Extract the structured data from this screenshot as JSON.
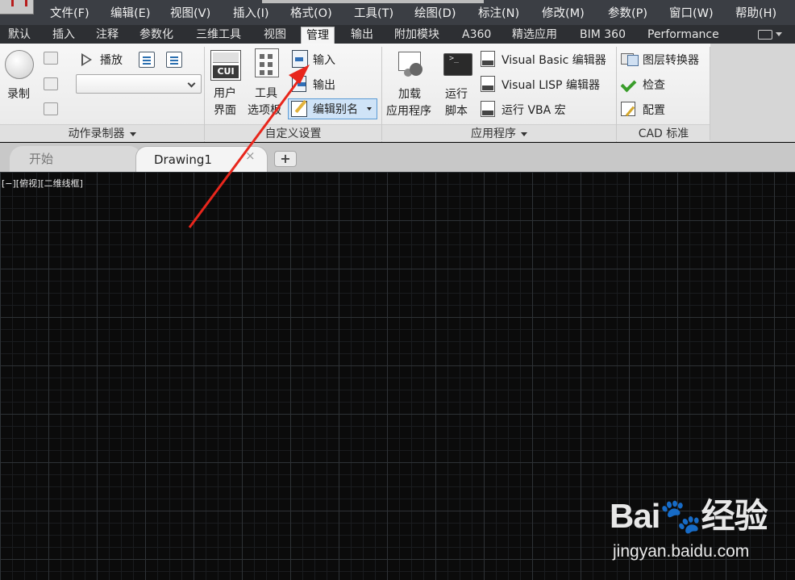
{
  "menu": {
    "items": [
      {
        "label": "文件(F)"
      },
      {
        "label": "编辑(E)"
      },
      {
        "label": "视图(V)"
      },
      {
        "label": "插入(I)"
      },
      {
        "label": "格式(O)"
      },
      {
        "label": "工具(T)"
      },
      {
        "label": "绘图(D)"
      },
      {
        "label": "标注(N)"
      },
      {
        "label": "修改(M)"
      },
      {
        "label": "参数(P)"
      },
      {
        "label": "窗口(W)"
      },
      {
        "label": "帮助(H)"
      }
    ]
  },
  "ribbon_tabs": [
    {
      "label": "默认"
    },
    {
      "label": "插入"
    },
    {
      "label": "注释"
    },
    {
      "label": "参数化"
    },
    {
      "label": "三维工具"
    },
    {
      "label": "视图"
    },
    {
      "label": "管理",
      "active": true
    },
    {
      "label": "输出"
    },
    {
      "label": "附加模块"
    },
    {
      "label": "A360"
    },
    {
      "label": "精选应用"
    },
    {
      "label": "BIM 360"
    },
    {
      "label": "Performance"
    }
  ],
  "panels": {
    "action_recorder": {
      "title": "动作录制器",
      "record_label": "录制",
      "play_label": "播放",
      "combo_value": ""
    },
    "customization": {
      "title": "自定义设置",
      "user_interface_line1": "用户",
      "user_interface_line2": "界面",
      "cui_text": "CUI",
      "tool_palettes_line1": "工具",
      "tool_palettes_line2": "选项板",
      "import_label": "输入",
      "export_label": "输出",
      "edit_aliases_label": "编辑别名"
    },
    "applications": {
      "title": "应用程序",
      "load_app_line1": "加载",
      "load_app_line2": "应用程序",
      "run_script_line1": "运行",
      "run_script_line2": "脚本",
      "vb_editor_label": "Visual Basic 编辑器",
      "lisp_editor_label": "Visual LISP 编辑器",
      "run_vba_label": "运行 VBA 宏"
    },
    "cad_standards": {
      "title": "CAD 标准",
      "layer_translator_label": "图层转换器",
      "check_label": "检查",
      "configure_label": "配置"
    }
  },
  "doc_tabs": {
    "start_label": "开始",
    "drawing_label": "Drawing1",
    "close_glyph": "×",
    "new_glyph": "+"
  },
  "viewport": {
    "control_label": "[−][俯视][二维线框]"
  },
  "watermark": {
    "logo_text": "Bai🐾经验",
    "url": "jingyan.baidu.com"
  },
  "colors": {
    "annotation_arrow": "#e8261c",
    "active_tab_bg": "#f5f5f5",
    "highlight_blue": "#5b9bd5"
  }
}
